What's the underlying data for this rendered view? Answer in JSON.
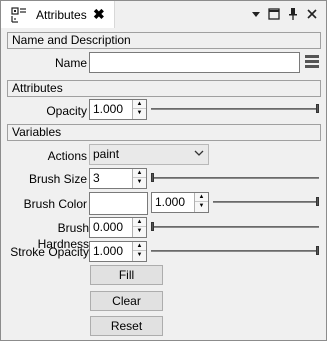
{
  "window": {
    "title": "Attributes",
    "close_glyph": "✖",
    "controls": {
      "dropdown_glyph": "▾",
      "float_glyph": "▭",
      "pin_glyph": "📌",
      "close_glyph": "✕"
    }
  },
  "name_section": {
    "header": "Name and Description",
    "name_label": "Name",
    "name_value": ""
  },
  "attributes_section": {
    "header": "Attributes",
    "opacity_label": "Opacity",
    "opacity_value": "1.000",
    "opacity_level": 1.0
  },
  "variables_section": {
    "header": "Variables",
    "actions_label": "Actions",
    "actions_value": "paint",
    "brush_size_label": "Brush Size",
    "brush_size_value": "3",
    "brush_size_level": 0.0,
    "brush_color_label": "Brush Color",
    "brush_color_value": "1.000",
    "brush_color_swatch": "#ffffff",
    "brush_color_level": 1.0,
    "brush_hardness_label": "Brush Hardness",
    "brush_hardness_value": "0.000",
    "brush_hardness_level": 0.0,
    "stroke_opacity_label": "Stroke Opacity",
    "stroke_opacity_value": "1.000",
    "stroke_opacity_level": 1.0
  },
  "buttons": {
    "fill": "Fill",
    "clear": "Clear",
    "reset": "Reset"
  },
  "icons": {
    "tab": "panel-icon",
    "menu": "hamburger-menu-icon"
  },
  "colors": {
    "background": "#f0f0f0",
    "field": "#ffffff",
    "border": "#7a7a7a"
  }
}
